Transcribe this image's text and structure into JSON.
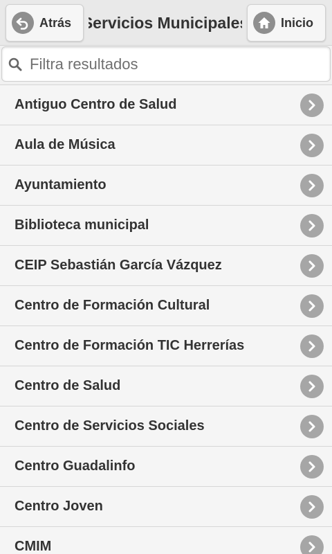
{
  "header": {
    "title": "Servicios Municipales",
    "back_label": "Atrás",
    "home_label": "Inicio"
  },
  "search": {
    "placeholder": "Filtra resultados",
    "value": ""
  },
  "list": {
    "items": [
      {
        "label": "Antiguo Centro de Salud"
      },
      {
        "label": "Aula de Música"
      },
      {
        "label": "Ayuntamiento"
      },
      {
        "label": "Biblioteca municipal"
      },
      {
        "label": "CEIP Sebastián García Vázquez"
      },
      {
        "label": "Centro de Formación Cultural"
      },
      {
        "label": "Centro de Formación TIC Herrerías"
      },
      {
        "label": "Centro de Salud"
      },
      {
        "label": "Centro de Servicios Sociales"
      },
      {
        "label": "Centro Guadalinfo"
      },
      {
        "label": "Centro Joven"
      },
      {
        "label": "CMIM"
      }
    ]
  },
  "icons": {
    "back": "back-arrow-icon",
    "home": "home-icon",
    "search": "search-icon",
    "item": "chevron-right-icon"
  }
}
